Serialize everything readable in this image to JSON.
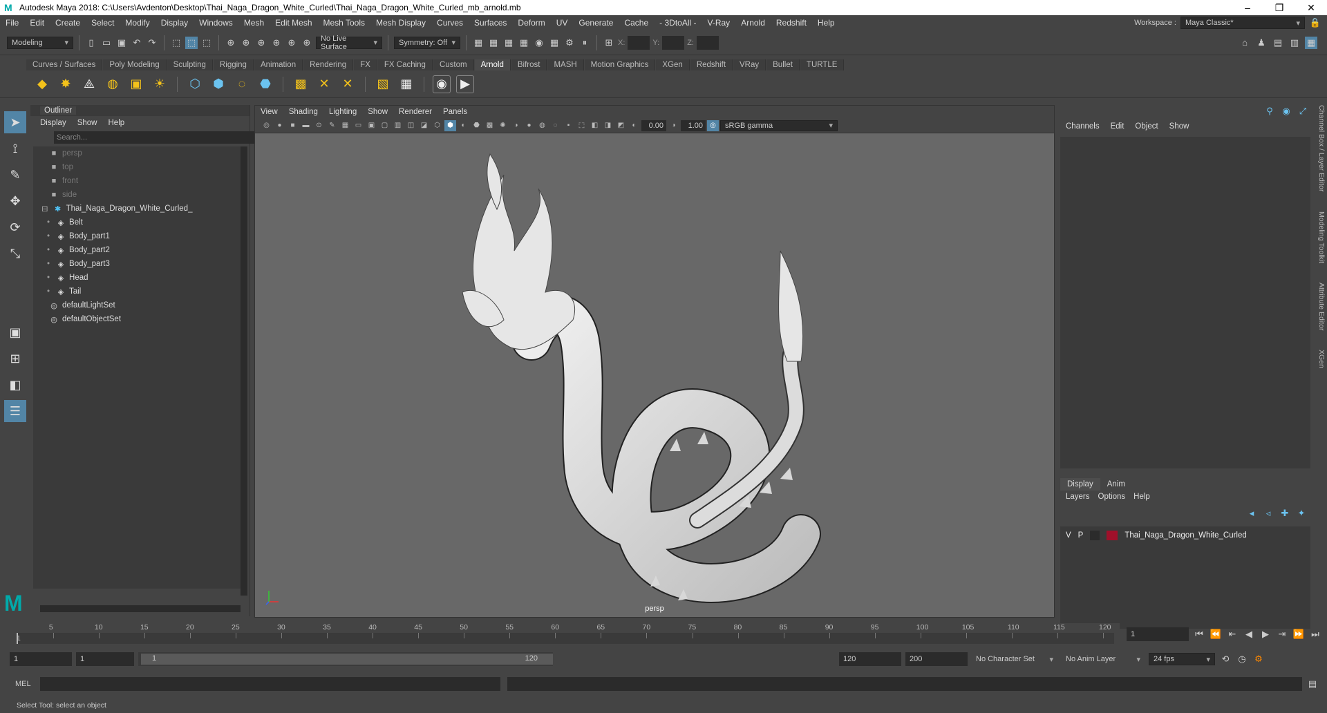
{
  "window": {
    "title": "Autodesk Maya 2018: C:\\Users\\Avdenton\\Desktop\\Thai_Naga_Dragon_White_Curled\\Thai_Naga_Dragon_White_Curled_mb_arnold.mb",
    "minimize": "–",
    "maximize": "❐",
    "close": "✕"
  },
  "menubar": {
    "items": [
      "File",
      "Edit",
      "Create",
      "Select",
      "Modify",
      "Display",
      "Windows",
      "Mesh",
      "Edit Mesh",
      "Mesh Tools",
      "Mesh Display",
      "Curves",
      "Surfaces",
      "Deform",
      "UV",
      "Generate",
      "Cache",
      "- 3DtoAll -",
      "V-Ray",
      "Arnold",
      "Redshift",
      "Help"
    ],
    "workspace_label": "Workspace :",
    "workspace_value": "Maya Classic*"
  },
  "statusline": {
    "mode": "Modeling",
    "live_surface": "No Live Surface",
    "symmetry": "Symmetry: Off",
    "x_label": "X:",
    "y_label": "Y:",
    "z_label": "Z:"
  },
  "shelf": {
    "tabs": [
      "Curves / Surfaces",
      "Poly Modeling",
      "Sculpting",
      "Rigging",
      "Animation",
      "Rendering",
      "FX",
      "FX Caching",
      "Custom",
      "Arnold",
      "Bifrost",
      "MASH",
      "Motion Graphics",
      "XGen",
      "Redshift",
      "VRay",
      "Bullet",
      "TURTLE"
    ],
    "active_tab": "Arnold"
  },
  "outliner": {
    "title": "Outliner",
    "menu": [
      "Display",
      "Show",
      "Help"
    ],
    "search_placeholder": "Search...",
    "items": [
      {
        "label": "persp",
        "icon": "camera-icon",
        "dim": true,
        "indent": 0
      },
      {
        "label": "top",
        "icon": "camera-icon",
        "dim": true,
        "indent": 0
      },
      {
        "label": "front",
        "icon": "camera-icon",
        "dim": true,
        "indent": 0
      },
      {
        "label": "side",
        "icon": "camera-icon",
        "dim": true,
        "indent": 0
      },
      {
        "label": "Thai_Naga_Dragon_White_Curled_",
        "icon": "group-icon",
        "dim": false,
        "indent": 0
      },
      {
        "label": "Belt",
        "icon": "mesh-icon",
        "dim": false,
        "indent": 1
      },
      {
        "label": "Body_part1",
        "icon": "mesh-icon",
        "dim": false,
        "indent": 1
      },
      {
        "label": "Body_part2",
        "icon": "mesh-icon",
        "dim": false,
        "indent": 1
      },
      {
        "label": "Body_part3",
        "icon": "mesh-icon",
        "dim": false,
        "indent": 1
      },
      {
        "label": "Head",
        "icon": "mesh-icon",
        "dim": false,
        "indent": 1
      },
      {
        "label": "Tail",
        "icon": "mesh-icon",
        "dim": false,
        "indent": 1
      },
      {
        "label": "defaultLightSet",
        "icon": "set-icon",
        "dim": false,
        "indent": 0
      },
      {
        "label": "defaultObjectSet",
        "icon": "set-icon",
        "dim": false,
        "indent": 0
      }
    ]
  },
  "viewport": {
    "menu": [
      "View",
      "Shading",
      "Lighting",
      "Show",
      "Renderer",
      "Panels"
    ],
    "exposure": "0.00",
    "gamma": "1.00",
    "colorspace": "sRGB gamma",
    "camera": "persp"
  },
  "channelbox": {
    "menu": [
      "Channels",
      "Edit",
      "Object",
      "Show"
    ]
  },
  "layereditor": {
    "tabs": [
      "Display",
      "Anim"
    ],
    "active_tab": "Display",
    "menu": [
      "Layers",
      "Options",
      "Help"
    ],
    "layer": {
      "v": "V",
      "p": "P",
      "name": "Thai_Naga_Dragon_White_Curled",
      "color": "#a0102a"
    }
  },
  "side_tabs": [
    "Channel Box / Layer Editor",
    "Modeling Toolkit",
    "Attribute Editor",
    "XGen"
  ],
  "timeline": {
    "ticks": [
      "5",
      "10",
      "15",
      "20",
      "25",
      "30",
      "35",
      "40",
      "45",
      "50",
      "55",
      "60",
      "65",
      "70",
      "75",
      "80",
      "85",
      "90",
      "95",
      "100",
      "105",
      "110",
      "115",
      "120"
    ],
    "start_marker": "1",
    "current_frame": "1"
  },
  "range": {
    "start": "1",
    "playback_start": "1",
    "slider_start": "1",
    "slider_end": "120",
    "playback_end": "120",
    "end": "200",
    "character_set": "No Character Set",
    "anim_layer": "No Anim Layer",
    "fps": "24 fps"
  },
  "cmdline": {
    "label": "MEL"
  },
  "helpline": {
    "text": "Select Tool: select an object"
  }
}
